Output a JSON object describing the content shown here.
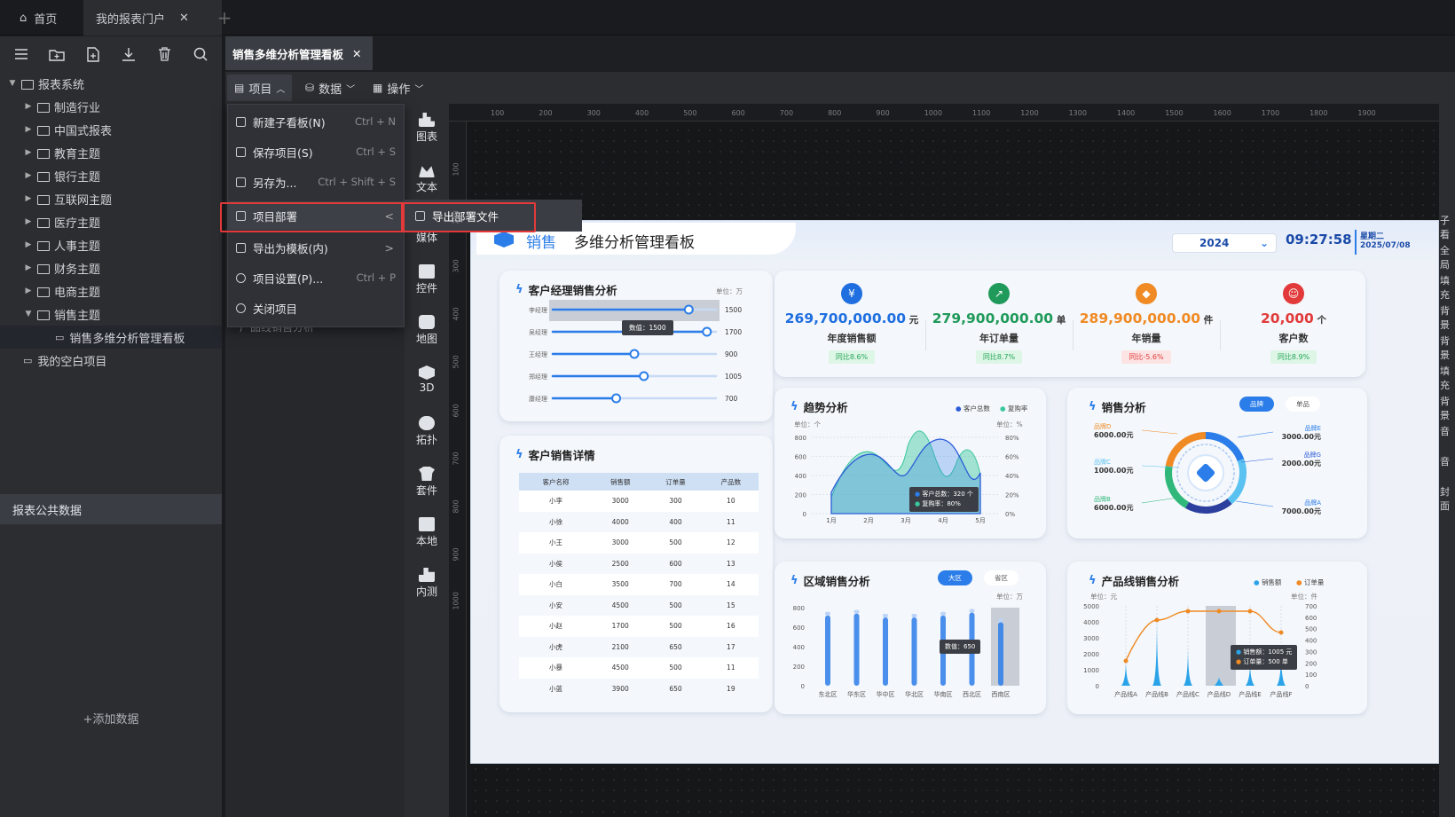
{
  "tabs": {
    "home": "首页",
    "portal": "我的报表门户",
    "add": "+"
  },
  "sidebar": {
    "root": "报表系统",
    "folders": [
      "制造行业",
      "中国式报表",
      "教育主题",
      "银行主题",
      "互联网主题",
      "医疗主题",
      "人事主题",
      "财务主题",
      "电商主题",
      "销售主题"
    ],
    "selected_item": "销售多维分析管理看板",
    "blank_item": "我的空白项目",
    "public_data": "报表公共数据",
    "add_data": "+添加数据"
  },
  "doc_tab": {
    "title": "销售多维分析管理看板"
  },
  "menubar": {
    "project": "项目",
    "data": "数据",
    "operate": "操作"
  },
  "dropdown": [
    {
      "label": "新建子看板(N)",
      "shortcut": "Ctrl + N"
    },
    {
      "label": "保存项目(S)",
      "shortcut": "Ctrl + S"
    },
    {
      "label": "另存为...",
      "shortcut": "Ctrl + Shift + S"
    },
    {
      "label": "项目部署",
      "shortcut": "<"
    },
    {
      "label": "导出为模板(内)",
      "shortcut": ">"
    },
    {
      "label": "项目设置(P)...",
      "shortcut": "Ctrl + P"
    },
    {
      "label": "关闭项目",
      "shortcut": ""
    }
  ],
  "submenu": {
    "label": "导出部署文件"
  },
  "left_panel_partial": "厂品线销售分析",
  "components": [
    "图表",
    "文本",
    "媒体",
    "控件",
    "地图",
    "3D",
    "拓扑",
    "套件",
    "本地",
    "内测"
  ],
  "ruler_h": [
    "100",
    "200",
    "300",
    "400",
    "500",
    "600",
    "700",
    "800",
    "900",
    "1000",
    "1100",
    "1200",
    "1300",
    "1400",
    "1500",
    "1600",
    "1700",
    "1800",
    "1900"
  ],
  "ruler_v": [
    "100",
    "200",
    "300",
    "400",
    "500",
    "600",
    "700",
    "800",
    "900",
    "1000"
  ],
  "right_strip": [
    "子看",
    "全局",
    "填充",
    "背景",
    "背景",
    "填充",
    "背景",
    "音",
    "音",
    "封面"
  ],
  "dashboard": {
    "title_accent": "销售",
    "title_rest": "多维分析管理看板",
    "year": "2024",
    "time": "09:27:58",
    "weekday": "星期二",
    "date": "2025/07/08",
    "kpis": [
      {
        "value": "269,700,000.00",
        "unit": "元",
        "label": "年度销售额",
        "badge": "同比8.6%",
        "color": "#1f6fe0",
        "icon": "¥",
        "badge_up": true
      },
      {
        "value": "279,900,000.00",
        "unit": "单",
        "label": "年订单量",
        "badge": "同比8.7%",
        "color": "#1f9a5a",
        "icon": "↗",
        "badge_up": true
      },
      {
        "value": "289,900,000.00",
        "unit": "件",
        "label": "年销量",
        "badge": "同比-5.6%",
        "color": "#f08a24",
        "icon": "◆",
        "badge_up": false
      },
      {
        "value": "20,000",
        "unit": "个",
        "label": "客户数",
        "badge": "同比8.9%",
        "color": "#e23a3a",
        "icon": "☺",
        "badge_up": true
      }
    ],
    "manager": {
      "title": "客户经理销售分析",
      "unit": "单位：万",
      "tooltip": "数值：1500",
      "rows": [
        {
          "name": "李经理",
          "value": 1500
        },
        {
          "name": "吴经理",
          "value": 1700
        },
        {
          "name": "王经理",
          "value": 900
        },
        {
          "name": "郑经理",
          "value": 1005
        },
        {
          "name": "康经理",
          "value": 700
        }
      ]
    },
    "detail": {
      "title": "客户销售详情",
      "headers": [
        "客户名称",
        "销售额",
        "订单量",
        "产品数"
      ],
      "rows": [
        [
          "小李",
          "3000",
          "300",
          "10"
        ],
        [
          "小徐",
          "4000",
          "400",
          "11"
        ],
        [
          "小王",
          "3000",
          "500",
          "12"
        ],
        [
          "小侯",
          "2500",
          "600",
          "13"
        ],
        [
          "小白",
          "3500",
          "700",
          "14"
        ],
        [
          "小安",
          "4500",
          "500",
          "15"
        ],
        [
          "小赵",
          "1700",
          "500",
          "16"
        ],
        [
          "小虎",
          "2100",
          "650",
          "17"
        ],
        [
          "小暴",
          "4500",
          "500",
          "11"
        ],
        [
          "小蓝",
          "3900",
          "650",
          "19"
        ]
      ]
    },
    "trend": {
      "title": "趋势分析",
      "legend": [
        "客户总数",
        "复购率"
      ],
      "unit_left": "单位：个",
      "unit_right": "单位：%",
      "left_ticks": [
        "800",
        "600",
        "400",
        "200",
        "0"
      ],
      "right_ticks": [
        "80%",
        "60%",
        "40%",
        "20%",
        "0%"
      ],
      "months": [
        "1月",
        "2月",
        "3月",
        "4月",
        "5月"
      ],
      "tooltip_a": "客户总数：320 个",
      "tooltip_b": "复购率：80%"
    },
    "sales": {
      "title": "销售分析",
      "tab_active": "品牌",
      "tab_inactive": "单品",
      "labels": [
        {
          "name": "品牌D",
          "value": "6000.00元"
        },
        {
          "name": "品牌C",
          "value": "1000.00元"
        },
        {
          "name": "品牌B",
          "value": "6000.00元"
        },
        {
          "name": "品牌E",
          "value": "3000.00元"
        },
        {
          "name": "品牌G",
          "value": "2000.00元"
        },
        {
          "name": "品牌A",
          "value": "7000.00元"
        }
      ]
    },
    "region": {
      "title": "区域销售分析",
      "tab_active": "大区",
      "tab_inactive": "省区",
      "unit": "单位：万",
      "ticks": [
        "800",
        "600",
        "400",
        "200",
        "0"
      ],
      "categories": [
        "东北区",
        "华东区",
        "华中区",
        "华北区",
        "华南区",
        "西北区",
        "西南区"
      ],
      "values": [
        720,
        740,
        700,
        700,
        720,
        750,
        650
      ],
      "tooltip": "数值：650"
    },
    "product": {
      "title": "产品线销售分析",
      "legend": [
        "销售额",
        "订单量"
      ],
      "unit_left": "单位：元",
      "unit_right": "单位：件",
      "left_ticks": [
        "5000",
        "4000",
        "3000",
        "2000",
        "1000",
        "0"
      ],
      "right_ticks": [
        "700",
        "600",
        "500",
        "400",
        "300",
        "200",
        "100",
        "0"
      ],
      "categories": [
        "产品线A",
        "产品线B",
        "产品线C",
        "产品线D",
        "产品线E",
        "产品线F"
      ],
      "tooltip_a": "销售额：1005 元",
      "tooltip_b": "订单量：500 单"
    }
  }
}
